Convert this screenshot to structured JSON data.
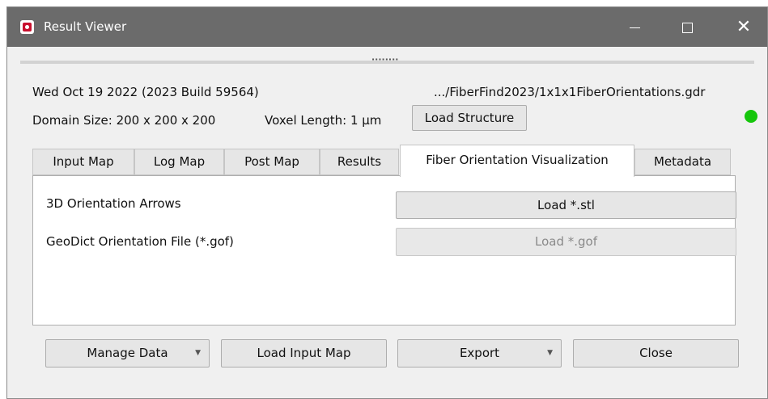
{
  "window": {
    "title": "Result Viewer",
    "controls": {
      "minimize": "minimize",
      "maximize": "maximize",
      "close": "✕"
    }
  },
  "info": {
    "date_build": "Wed Oct 19 2022 (2023 Build 59564)",
    "file_path": ".../FiberFind2023/1x1x1FiberOrientations.gdr",
    "domain_size": "Domain Size: 200 x 200 x 200",
    "voxel_length": "Voxel Length: 1 µm",
    "load_structure_label": "Load Structure",
    "status_color": "#16c60c"
  },
  "tabs": [
    {
      "label": "Input Map",
      "active": false
    },
    {
      "label": "Log Map",
      "active": false
    },
    {
      "label": "Post Map",
      "active": false
    },
    {
      "label": "Results",
      "active": false
    },
    {
      "label": "Fiber Orientation Visualization",
      "active": true
    },
    {
      "label": "Metadata",
      "active": false
    }
  ],
  "panel": {
    "rows": [
      {
        "label": "3D Orientation Arrows",
        "button": "Load *.stl",
        "enabled": true
      },
      {
        "label": "GeoDict Orientation File (*.gof)",
        "button": "Load *.gof",
        "enabled": false
      }
    ]
  },
  "footer": {
    "manage_data": "Manage Data",
    "load_input_map": "Load Input Map",
    "export": "Export",
    "close": "Close"
  }
}
